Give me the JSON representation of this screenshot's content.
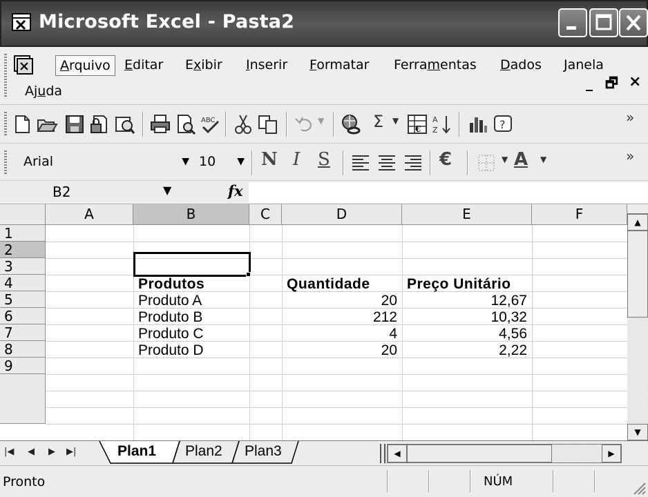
{
  "window": {
    "title": "Microsoft Excel - Pasta2",
    "minimize_label": "_",
    "restore_label": "🗗",
    "close_label": "✕"
  },
  "menu": {
    "items": [
      {
        "label": "Arquivo",
        "accel": "A"
      },
      {
        "label": "Editar",
        "accel": "E"
      },
      {
        "label": "Exibir",
        "accel": "x"
      },
      {
        "label": "Inserir",
        "accel": "I"
      },
      {
        "label": "Formatar",
        "accel": "F"
      },
      {
        "label": "Ferramentas",
        "accel": "m"
      },
      {
        "label": "Dados",
        "accel": "D"
      },
      {
        "label": "Janela",
        "accel": "J"
      },
      {
        "label": "Ajuda",
        "accel": "u"
      }
    ],
    "mdi_min": "_",
    "mdi_restore": "🗗",
    "mdi_close": "×"
  },
  "toolbar_standard": {
    "icons": [
      "new-icon",
      "open-icon",
      "save-icon",
      "permission-icon",
      "research-icon",
      "print-icon",
      "print-preview-icon",
      "spelling-icon",
      "cut-icon",
      "copy-icon",
      "undo-icon",
      "hyperlink-icon",
      "autosum-icon",
      "insert-function-icon",
      "sort-ascending-icon",
      "chart-wizard-icon",
      "help-icon",
      "overflow-icon"
    ],
    "autosum": "Σ",
    "overflow": "»"
  },
  "toolbar_formatting": {
    "font": "Arial",
    "size": "10",
    "bold": "N",
    "italic": "I",
    "underline": "S",
    "currency": "€",
    "font_color": "A",
    "overflow": "»"
  },
  "formula_bar": {
    "name_box": "B2",
    "fx": "fx",
    "formula": ""
  },
  "grid": {
    "columns": [
      "A",
      "B",
      "C",
      "D",
      "E",
      "F"
    ],
    "rows": [
      "1",
      "2",
      "3",
      "4",
      "5",
      "6",
      "7",
      "8",
      "9"
    ],
    "cells": {
      "B4": "Produtos",
      "D4": "Quantidade",
      "E4": "Preço Unitário",
      "B5": "Produto A",
      "D5": "20",
      "E5": "12,67",
      "B6": "Produto B",
      "D6": "212",
      "E6": "10,32",
      "B7": "Produto C",
      "D7": "4",
      "E7": "4,56",
      "B8": "Produto D",
      "D8": "20",
      "E8": "2,22"
    },
    "active_cell": "B2"
  },
  "sheets": {
    "tabs": [
      "Plan1",
      "Plan2",
      "Plan3"
    ],
    "active": "Plan1"
  },
  "status": {
    "text": "Pronto",
    "num": "NÚM"
  }
}
